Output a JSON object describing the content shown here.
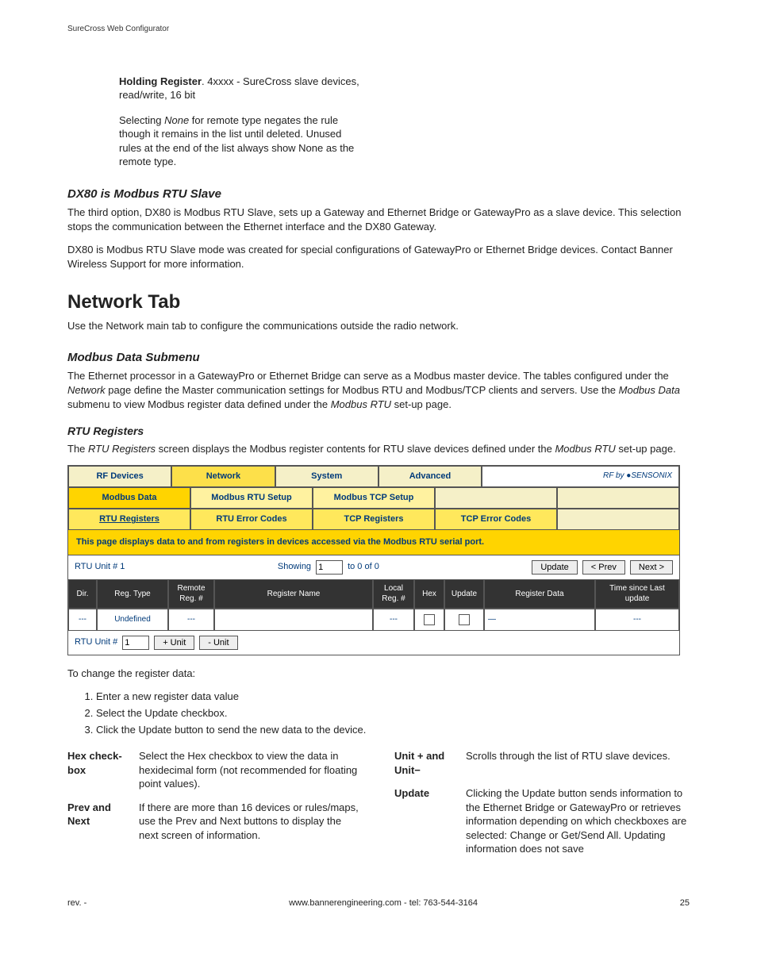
{
  "header": {
    "title": "SureCross Web Configurator"
  },
  "intro": {
    "block1_bold": "Holding Register",
    "block1_rest": ". 4xxxx - SureCross slave devices, read/write, 16 bit",
    "block2_a": "Selecting ",
    "block2_i": "None",
    "block2_b": " for remote type negates the rule though it remains in the list until deleted. Unused rules at the end of the list always show None as the remote type."
  },
  "dx80": {
    "heading": "DX80 is Modbus RTU Slave",
    "p1": "The third option, DX80 is Modbus RTU Slave, sets up a Gateway and Ethernet Bridge or GatewayPro as a slave device. This selection stops the communication between the Ethernet interface and the DX80 Gateway.",
    "p2": "DX80 is Modbus RTU Slave mode was created for special configurations of GatewayPro or Ethernet Bridge devices. Contact Banner Wireless Support for more information."
  },
  "network": {
    "heading": "Network Tab",
    "p": "Use the Network main tab to configure the communications outside the radio network."
  },
  "modbus": {
    "heading": "Modbus Data Submenu",
    "p_a": "The Ethernet processor in a GatewayPro or Ethernet Bridge can serve as a Modbus master device. The tables configured under the ",
    "p_i1": "Network",
    "p_b": " page define the Master communication settings for Modbus RTU and Modbus/TCP clients and servers. Use the ",
    "p_i2": "Modbus Data",
    "p_c": " submenu to view Modbus register data defined under the ",
    "p_i3": "Modbus RTU",
    "p_d": " set-up page."
  },
  "rtu": {
    "heading": "RTU Registers",
    "p_a": "The ",
    "p_i1": "RTU Registers",
    "p_b": " screen displays the Modbus register contents for RTU slave devices defined under the ",
    "p_i2": "Modbus RTU",
    "p_c": " set-up page."
  },
  "ui": {
    "tabs": [
      "RF Devices",
      "Network",
      "System",
      "Advanced"
    ],
    "brand": "RF by ●SENSONIX",
    "subtabs": [
      "Modbus Data",
      "Modbus RTU Setup",
      "Modbus TCP Setup"
    ],
    "thirdtabs": [
      "RTU Registers",
      "RTU Error Codes",
      "TCP Registers",
      "TCP Error Codes"
    ],
    "desc": "This page displays data to and from registers in devices accessed via the Modbus RTU serial port.",
    "unit_label": "RTU Unit # 1",
    "showing_label": "Showing",
    "showing_value": "1",
    "showing_suffix": "to 0 of 0",
    "btn_update": "Update",
    "btn_prev": "< Prev",
    "btn_next": "Next >",
    "headers": {
      "dir": "Dir.",
      "type": "Reg. Type",
      "remote": "Remote Reg. #",
      "name": "Register Name",
      "local": "Local Reg. #",
      "hex": "Hex",
      "update": "Update",
      "data": "Register Data",
      "time": "Time since Last update"
    },
    "row": {
      "dir": "---",
      "type": "Undefined",
      "remote": "---",
      "name": "",
      "local": "---",
      "data": "—",
      "time": "---"
    },
    "bottom_label": "RTU Unit #",
    "bottom_value": "1",
    "plus": "+ Unit",
    "minus": "- Unit"
  },
  "change": {
    "intro": "To change the register data:",
    "steps": [
      "Enter a new register data value",
      "Select the Update checkbox.",
      "Click the Update button to send the new data to the device."
    ]
  },
  "defs": {
    "left": [
      {
        "term": "Hex check-box",
        "body": "Select the Hex checkbox to view the data in hexidecimal form (not recommended for floating point values)."
      },
      {
        "term": "Prev and Next",
        "body": "If there are more than 16 devices or rules/maps, use the Prev and Next buttons to display the next screen of information."
      }
    ],
    "right": [
      {
        "term": "Unit + and Unit−",
        "body": "Scrolls through the list of RTU slave devices."
      },
      {
        "term": "Update",
        "body": "Clicking the Update button sends information to the Ethernet Bridge or GatewayPro or retrieves information depending on which checkboxes are selected: Change or Get/Send All. Updating information does not save"
      }
    ]
  },
  "footer": {
    "rev": "rev. -",
    "center": "www.bannerengineering.com - tel: 763-544-3164",
    "page": "25"
  }
}
